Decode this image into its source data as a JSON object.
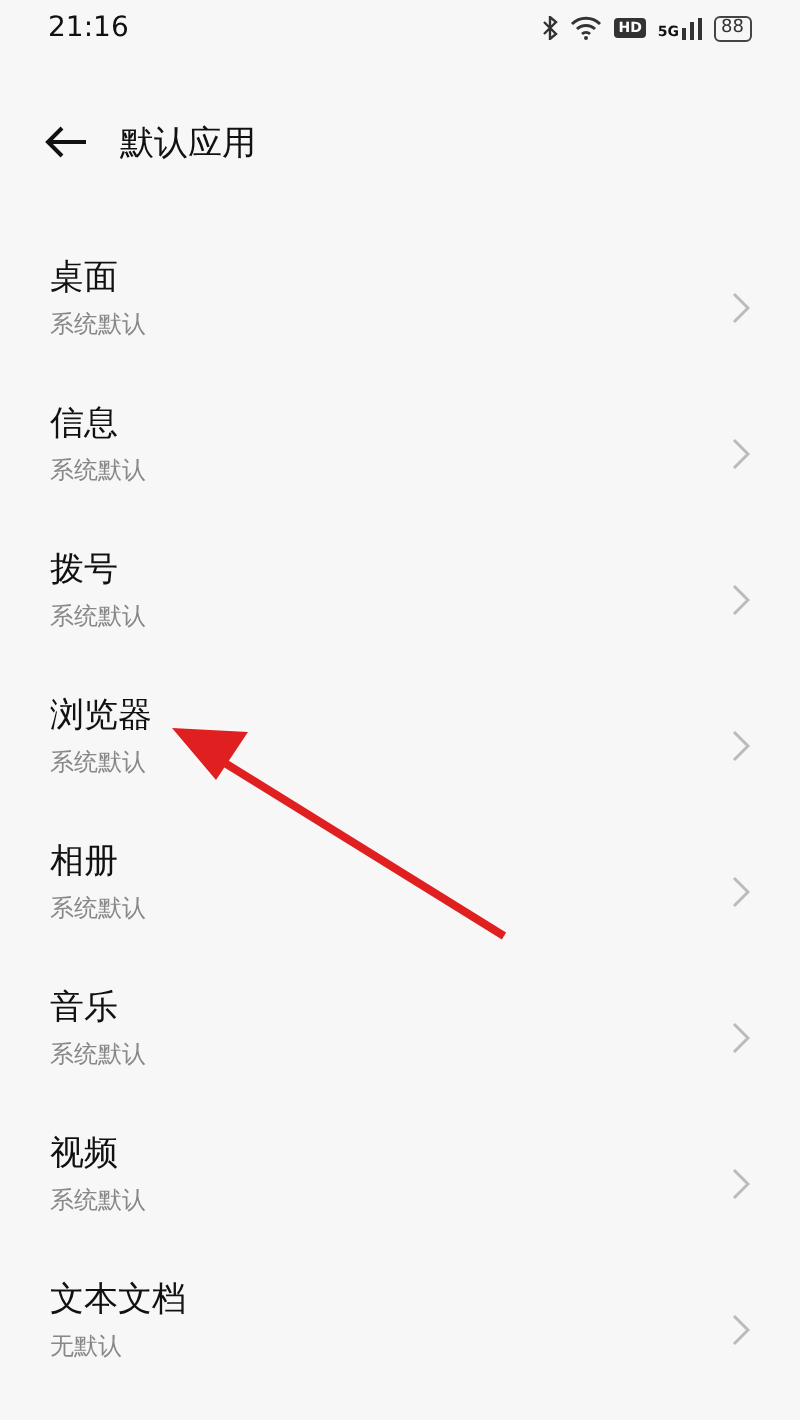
{
  "status_bar": {
    "time": "21:16",
    "hd": "HD",
    "network": "5G",
    "battery": "88"
  },
  "header": {
    "title": "默认应用"
  },
  "items": [
    {
      "title": "桌面",
      "subtitle": "系统默认"
    },
    {
      "title": "信息",
      "subtitle": "系统默认"
    },
    {
      "title": "拨号",
      "subtitle": "系统默认"
    },
    {
      "title": "浏览器",
      "subtitle": "系统默认"
    },
    {
      "title": "相册",
      "subtitle": "系统默认"
    },
    {
      "title": "音乐",
      "subtitle": "系统默认"
    },
    {
      "title": "视频",
      "subtitle": "系统默认"
    },
    {
      "title": "文本文档",
      "subtitle": "无默认"
    }
  ]
}
